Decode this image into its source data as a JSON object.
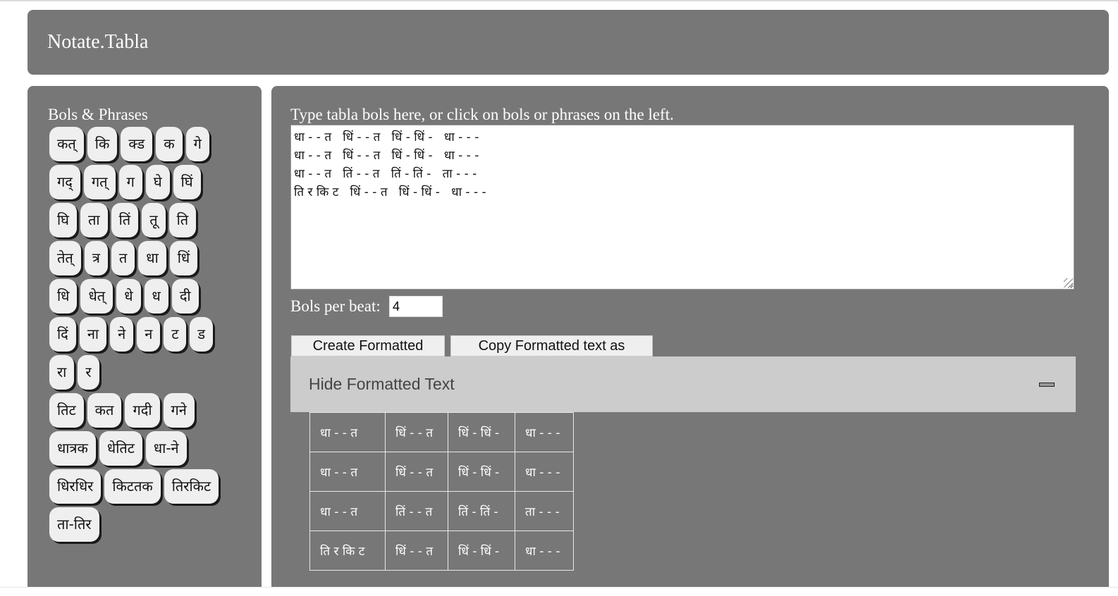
{
  "header": {
    "title": "Notate.Tabla"
  },
  "sidebar": {
    "heading": "Bols & Phrases",
    "rows": [
      [
        "कत्",
        "कि",
        "क्ड",
        "क",
        "गे"
      ],
      [
        "गद्",
        "गत्",
        "ग",
        "घे",
        "घिं"
      ],
      [
        "घि",
        "ता",
        "तिं",
        "तू",
        "ति"
      ],
      [
        "तेत्",
        "त्र",
        "त",
        "धा",
        "धिं"
      ],
      [
        "धि",
        "धेत्",
        "धे",
        "ध",
        "दी"
      ],
      [
        "दिं",
        "ना",
        "ने",
        "न",
        "ट",
        "ड"
      ],
      [
        "रा",
        "र"
      ],
      [
        "तिट",
        "कत",
        "गदी",
        "गने"
      ],
      [
        "धात्रक",
        "धेतिट",
        "धा-ने"
      ],
      [
        "धिरधिर",
        "किटतक",
        "तिरकिट"
      ],
      [
        "ता-तिर"
      ]
    ]
  },
  "main": {
    "instructions": "Type tabla bols here, or click on bols or phrases on the left.",
    "textarea_value": "धा - - त   धिं - - त   धिं - धिं -   धा - - -\nधा - - त   धिं - - त   धिं - धिं -   धा - - -\nधा - - त   तिं - - त   तिं - तिं -   ता - - -\nति र कि ट   धिं - - त   धिं - धिं -   धा - - -",
    "bols_per_beat_label": "Bols per beat:",
    "bols_per_beat_value": "4",
    "create_button": "Create Formatted Text",
    "copy_button": "Copy Formatted text as HTML",
    "collapsible_label": "Hide Formatted Text",
    "collapse_icon": "minus-icon",
    "formatted_table": [
      [
        "धा - - त",
        "धिं - - त",
        "धिं - धिं -",
        "धा - - -"
      ],
      [
        "धा - - त",
        "धिं - - त",
        "धिं - धिं -",
        "धा - - -"
      ],
      [
        "धा - - त",
        "तिं - - त",
        "तिं - तिं -",
        "ता - - -"
      ],
      [
        "ति र कि ट",
        "धिं - - त",
        "धिं - धिं -",
        "धा - - -"
      ]
    ]
  },
  "colors": {
    "panel_bg": "#777777",
    "bol_button_bg": "#efefef",
    "collapsible_bg": "#cccccc",
    "page_bg": "#ffffff"
  }
}
